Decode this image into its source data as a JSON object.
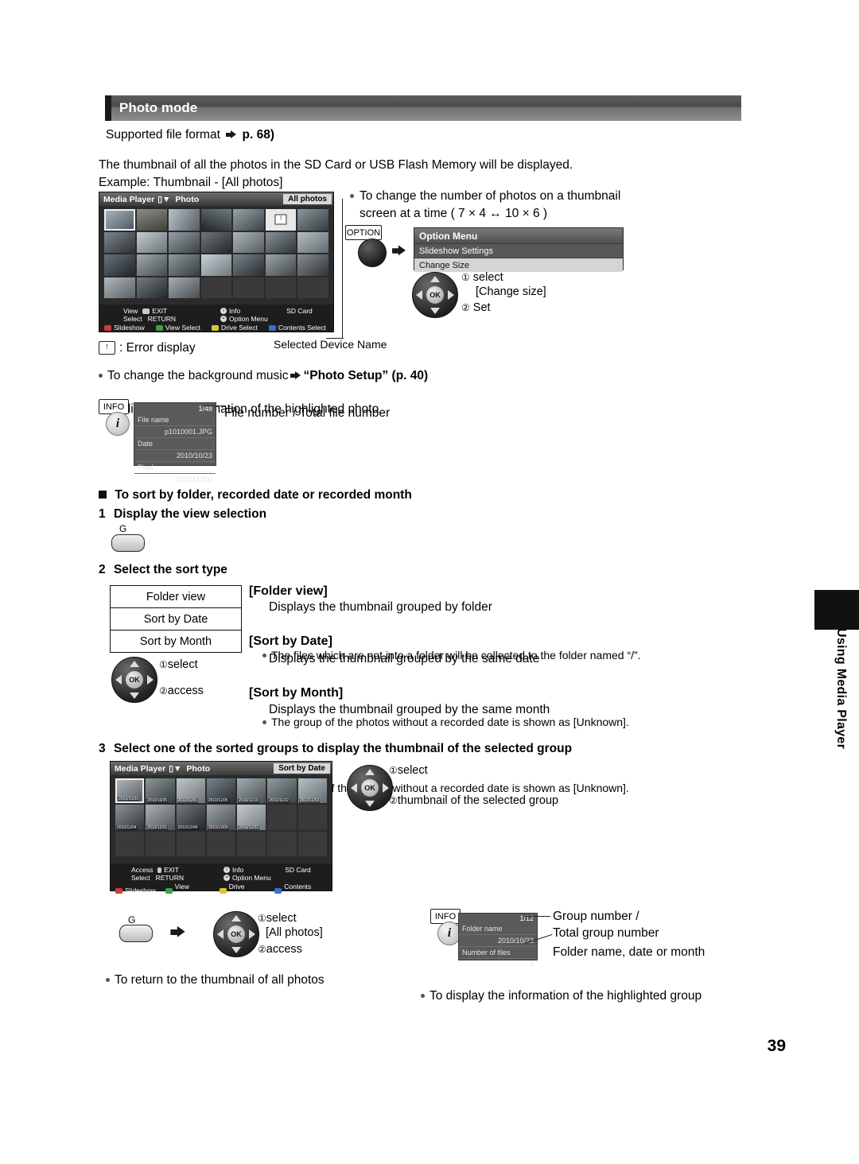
{
  "page": {
    "number": "39",
    "side_tab_label": "Using Media Player",
    "heading": "Photo mode"
  },
  "intro": {
    "supported_format_label": "Supported file format",
    "supported_format_ref": "p. 68)",
    "desc": "The thumbnail of all the photos in the SD Card or USB Flash Memory will be displayed.",
    "example": "Example: Thumbnail - [All photos]"
  },
  "screen1": {
    "head_title": "Media Player",
    "head_mode": "Photo",
    "tag": "All photos",
    "thumb_rows": 4,
    "thumb_cols": 7,
    "footer": {
      "view": "View",
      "exit": "EXIT",
      "info": "Info",
      "sdcard": "SD Card",
      "select": "Select",
      "return": "RETURN",
      "option_menu": "Option Menu",
      "slideshow": "Slideshow",
      "view_select": "View Select",
      "drive_select": "Drive Select",
      "contents_select": "Contents Select"
    }
  },
  "callouts": {
    "change_number": "To change the number of photos on a thumbnail",
    "change_number2": "screen at a time ( 7 × 4 ↔ 10 × 6 )",
    "option_button": "OPTION",
    "option_menu_title": "Option Menu",
    "option_items": [
      "Slideshow Settings",
      "Change Size"
    ],
    "select_1": "select",
    "select_1_val": "[Change size]",
    "set_2": "Set",
    "error_display": ": Error display",
    "error_icon_glyph": "!",
    "selected_device": "Selected Device Name",
    "bg_music": "To change the background music",
    "bg_music_ref": "“Photo Setup” (p. 40)",
    "info_highlight": "To display the information of the highlighted photo",
    "file_number_caption": "File number / Total file number"
  },
  "infobox1": {
    "button": "INFO",
    "counter": "1/48",
    "rows": [
      {
        "label": "File name",
        "value": "p1010001.JPG"
      },
      {
        "label": "Date",
        "value": "2010/10/23"
      },
      {
        "label": "Pixel",
        "value": "1600X1200"
      }
    ]
  },
  "sort_section": {
    "heading": "To sort by folder, recorded date or recorded month",
    "step1_num": "1",
    "step1": "Display the view selection",
    "g_button": "G",
    "step2_num": "2",
    "step2": "Select the sort type",
    "options": [
      "Folder view",
      "Sort by Date",
      "Sort by Month"
    ],
    "select_1": "select",
    "access_2": "access",
    "folder_view_title": "[Folder view]",
    "folder_view_desc": "Displays the thumbnail grouped by folder",
    "folder_view_note": "The files which are not into a folder will be collected to the folder named “/”.",
    "sort_date_title": "[Sort by Date]",
    "sort_date_desc": "Displays the thumbnail grouped by the same date",
    "sort_date_note": "The group of the photos without a recorded date is shown as [Unknown].",
    "sort_month_title": "[Sort by Month]",
    "sort_month_desc": "Displays the thumbnail grouped by the same month",
    "sort_month_note": "The group of the photos without a recorded date is shown as [Unknown]."
  },
  "step3": {
    "num": "3",
    "text": "Select one of the sorted groups to display the thumbnail of the selected group",
    "select_1": "select",
    "thumb_2": "thumbnail of the selected group"
  },
  "screen2": {
    "head_title": "Media Player",
    "head_mode": "Photo",
    "tag": "Sort by Date",
    "dates_row1": [
      "2010/10/23",
      "2010/10/25",
      "2010/11/01",
      "2010/11/05",
      "2010/11/10",
      "2010/11/22",
      "2010/11/03"
    ],
    "dates_row2": [
      "2010/11/04",
      "2010/12/01",
      "2010/12/49",
      "2010/12/09",
      "2010/12/22",
      "",
      ""
    ],
    "footer": {
      "access": "Access",
      "exit": "EXIT",
      "info": "Info",
      "sdcard": "SD Card",
      "select": "Select",
      "return": "RETURN",
      "option_menu": "Option Menu",
      "slideshow": "Slideshow",
      "view_select": "View Select",
      "drive_select": "Drive Select",
      "contents_select": "Contents Select"
    }
  },
  "bottom": {
    "return_all": "To return to the thumbnail of all photos",
    "g_button": "G",
    "select_1": "select",
    "all_photos": "[All photos]",
    "access_2": "access",
    "info_group": "To display the information of the highlighted group",
    "group_number": "Group number /",
    "total_group": "Total group number",
    "folder_name_cap": "Folder name, date or month"
  },
  "infobox2": {
    "button": "INFO",
    "counter": "1/12",
    "rows": [
      {
        "label": "Folder name",
        "value": ""
      },
      {
        "label": "",
        "value": "2010/10/23"
      },
      {
        "label": "Number of files",
        "value": ""
      },
      {
        "label": "",
        "value": "3"
      }
    ]
  }
}
